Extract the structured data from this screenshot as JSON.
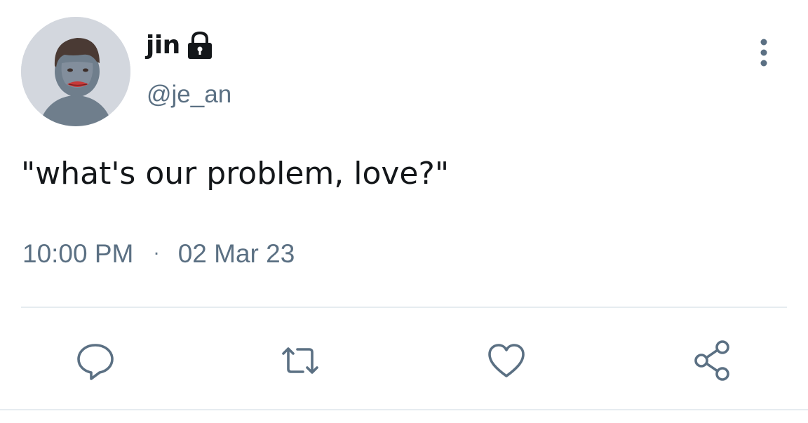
{
  "user": {
    "display_name": "jin",
    "handle": "@je_an",
    "protected": true
  },
  "tweet": {
    "text": "\"what's our problem, love?\"",
    "time": "10:00 PM",
    "separator": "·",
    "date": "02 Mar 23"
  },
  "icons": {
    "lock": "lock-icon",
    "more": "more-vertical-icon",
    "reply": "reply-icon",
    "retweet": "retweet-icon",
    "like": "heart-icon",
    "share": "share-icon"
  },
  "colors": {
    "text_primary": "#14171a",
    "text_secondary": "#5b7083",
    "divider": "#e6ecf0",
    "avatar_bg": "#d3d7de",
    "avatar_figure": "#6f7e8c"
  }
}
